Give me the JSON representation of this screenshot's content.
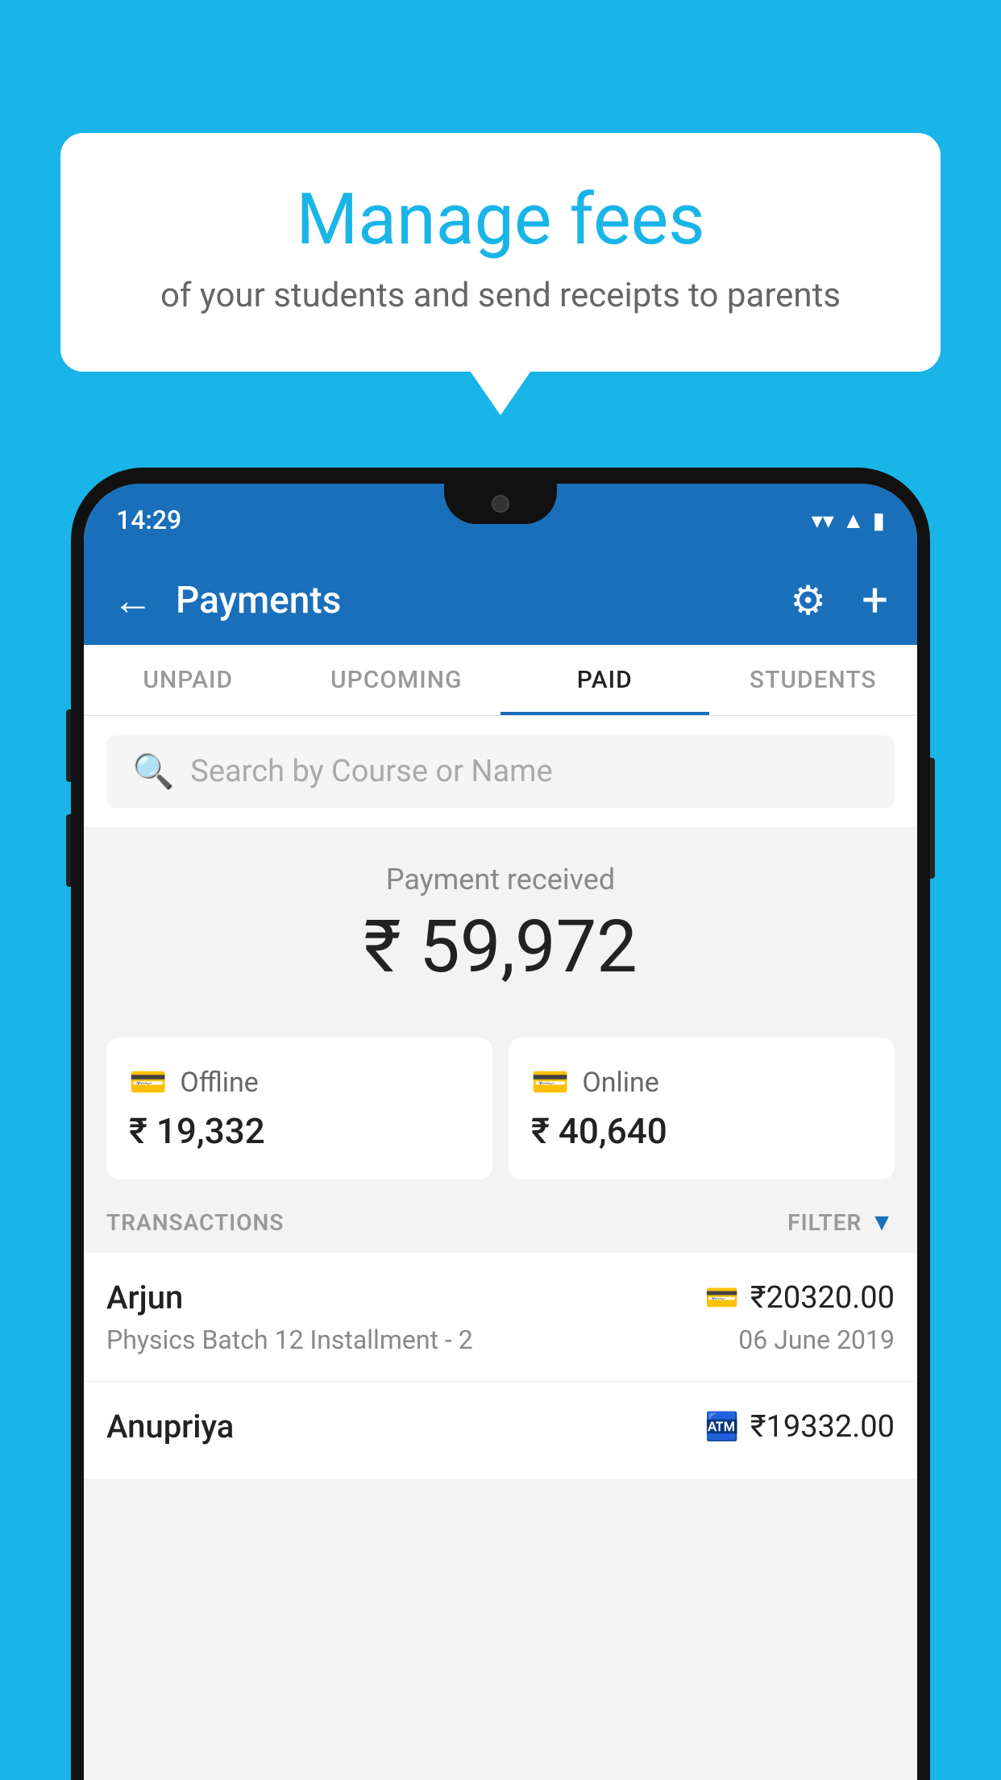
{
  "page": {
    "background_color": "#1ab5e8"
  },
  "speech_bubble": {
    "title": "Manage fees",
    "subtitle": "of your students and send receipts to parents"
  },
  "status_bar": {
    "time": "14:29",
    "wifi_icon": "wifi-icon",
    "signal_icon": "signal-icon",
    "battery_icon": "battery-icon"
  },
  "header": {
    "title": "Payments",
    "back_label": "←",
    "gear_label": "⚙",
    "plus_label": "+"
  },
  "tabs": [
    {
      "label": "UNPAID",
      "active": false
    },
    {
      "label": "UPCOMING",
      "active": false
    },
    {
      "label": "PAID",
      "active": true
    },
    {
      "label": "STUDENTS",
      "active": false
    }
  ],
  "search": {
    "placeholder": "Search by Course or Name"
  },
  "payment_received": {
    "label": "Payment received",
    "amount": "₹ 59,972"
  },
  "payment_modes": [
    {
      "icon": "💳",
      "label": "Offline",
      "amount": "₹ 19,332"
    },
    {
      "icon": "💳",
      "label": "Online",
      "amount": "₹ 40,640"
    }
  ],
  "transactions_section": {
    "label": "TRANSACTIONS",
    "filter_label": "FILTER"
  },
  "transactions": [
    {
      "name": "Arjun",
      "amount": "₹20320.00",
      "course": "Physics Batch 12 Installment - 2",
      "date": "06 June 2019",
      "payment_type": "card"
    },
    {
      "name": "Anupriya",
      "amount": "₹19332.00",
      "course": "",
      "date": "",
      "payment_type": "offline"
    }
  ]
}
